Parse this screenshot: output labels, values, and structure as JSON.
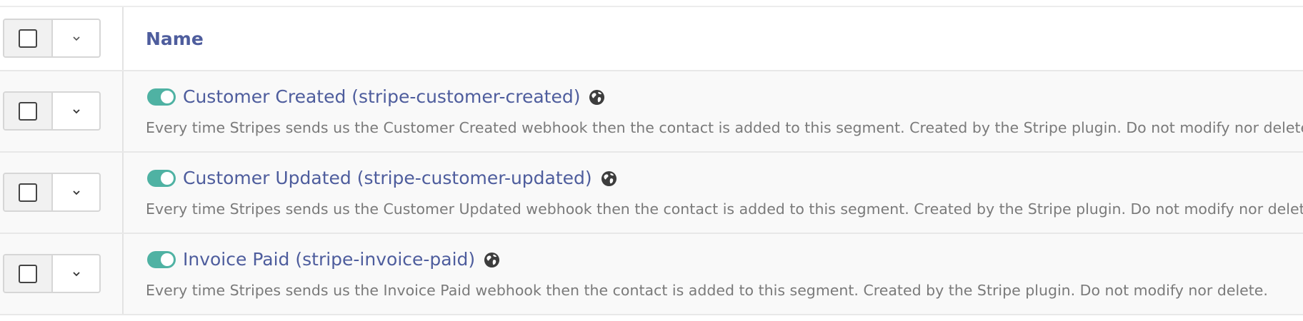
{
  "table": {
    "column_name_header": "Name",
    "rows": [
      {
        "toggle_on": true,
        "name": "Customer Created (stripe-customer-created)",
        "icon": "globe-icon",
        "description": "Every time Stripes sends us the Customer Created webhook then the contact is added to this segment. Created by the Stripe plugin. Do not modify nor delete."
      },
      {
        "toggle_on": true,
        "name": "Customer Updated (stripe-customer-updated)",
        "icon": "globe-icon",
        "description": "Every time Stripes sends us the Customer Updated webhook then the contact is added to this segment. Created by the Stripe plugin. Do not modify nor delete."
      },
      {
        "toggle_on": true,
        "name": "Invoice Paid (stripe-invoice-paid)",
        "icon": "globe-icon",
        "description": "Every time Stripes sends us the Invoice Paid webhook then the contact is added to this segment. Created by the Stripe plugin. Do not modify nor delete."
      }
    ]
  },
  "colors": {
    "link": "#4e5d9d",
    "toggle_on": "#4fb2a3",
    "description": "#7a7a7a",
    "row_background": "#f9f9f9"
  }
}
